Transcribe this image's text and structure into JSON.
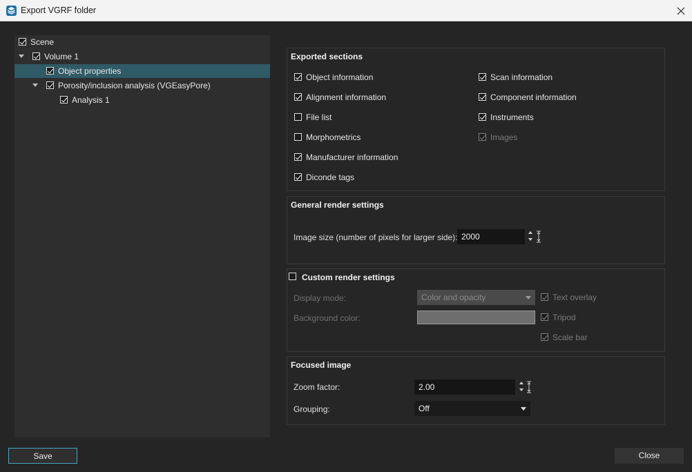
{
  "window": {
    "title": "Export VGRF folder"
  },
  "tree": {
    "items": [
      {
        "label": "Scene",
        "checked": true
      },
      {
        "label": "Volume 1",
        "checked": true
      },
      {
        "label": "Object properties",
        "checked": true,
        "selected": true
      },
      {
        "label": "Porosity/inclusion analysis (VGEasyPore)",
        "checked": true
      },
      {
        "label": "Analysis 1",
        "checked": true
      }
    ]
  },
  "exported_sections": {
    "title": "Exported sections",
    "left": [
      {
        "label": "Object information",
        "checked": true
      },
      {
        "label": "Alignment information",
        "checked": true
      },
      {
        "label": "File list",
        "checked": false
      },
      {
        "label": "Morphometrics",
        "checked": false
      },
      {
        "label": "Manufacturer information",
        "checked": true
      },
      {
        "label": "Diconde tags",
        "checked": true
      }
    ],
    "right": [
      {
        "label": "Scan information",
        "checked": true
      },
      {
        "label": "Component information",
        "checked": true
      },
      {
        "label": "Instruments",
        "checked": true
      },
      {
        "label": "Images",
        "checked": true,
        "disabled": true
      }
    ]
  },
  "general_render": {
    "title": "General render settings",
    "image_size_label": "Image size (number of pixels for larger side):",
    "image_size_value": "2000"
  },
  "custom_render": {
    "title": "Custom render settings",
    "enabled": false,
    "display_mode_label": "Display mode:",
    "display_mode_value": "Color and opacity",
    "background_color_label": "Background color:",
    "background_color": "#6e6e6e",
    "text_overlay_label": "Text overlay",
    "tripod_label": "Tripod",
    "scale_bar_label": "Scale bar"
  },
  "focused_image": {
    "title": "Focused image",
    "zoom_label": "Zoom factor:",
    "zoom_value": "2.00",
    "grouping_label": "Grouping:",
    "grouping_value": "Off"
  },
  "buttons": {
    "save": "Save",
    "close": "Close"
  },
  "colors": {
    "accent": "#4aa3c8",
    "selection": "#2f5a66",
    "background": "#252525"
  }
}
